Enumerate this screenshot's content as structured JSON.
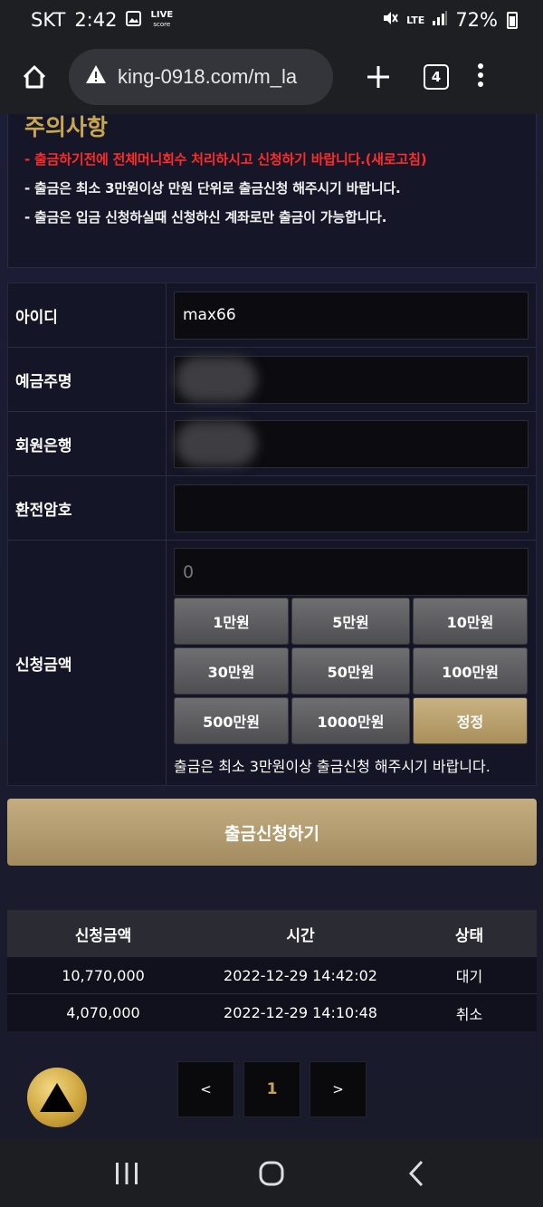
{
  "status_bar": {
    "carrier": "SKT",
    "time": "2:42",
    "live_badge_top": "LIVE",
    "live_badge_bottom": "score",
    "network": "LTE",
    "battery": "72%"
  },
  "browser": {
    "url": "king-0918.com/m_la",
    "tab_count": "4"
  },
  "notice": {
    "title": "주의사항",
    "lines": [
      "- 출금하기전에 전체머니회수 처리하시고 신청하기 바랍니다.(새로고침)",
      "- 출금은 최소 3만원이상 만원 단위로 출금신청 해주시기 바랍니다.",
      "- 출금은 입금 신청하실때 신청하신 계좌로만 출금이 가능합니다."
    ]
  },
  "form": {
    "id_label": "아이디",
    "id_value": "max66",
    "depositor_label": "예금주명",
    "bank_label": "회원은행",
    "password_label": "환전암호",
    "amount_label": "신청금액",
    "amount_placeholder": "0",
    "amount_buttons": [
      "1만원",
      "5만원",
      "10만원",
      "30만원",
      "50만원",
      "100만원",
      "500만원",
      "1000만원"
    ],
    "reset_button": "정정",
    "amount_note": "출금은 최소 3만원이상 출금신청 해주시기 바랍니다."
  },
  "submit_label": "출금신청하기",
  "history": {
    "headers": [
      "신청금액",
      "시간",
      "상태"
    ],
    "rows": [
      {
        "amount": "10,770,000",
        "time": "2022-12-29 14:42:02",
        "status": "대기"
      },
      {
        "amount": "4,070,000",
        "time": "2022-12-29 14:10:48",
        "status": "취소"
      }
    ]
  },
  "pagination": {
    "prev": "<",
    "current": "1",
    "next": ">"
  },
  "colors": {
    "accent_gold": "#c9a54f",
    "notice_red": "#ff2a2a",
    "button_gold": "#b89f6f"
  }
}
